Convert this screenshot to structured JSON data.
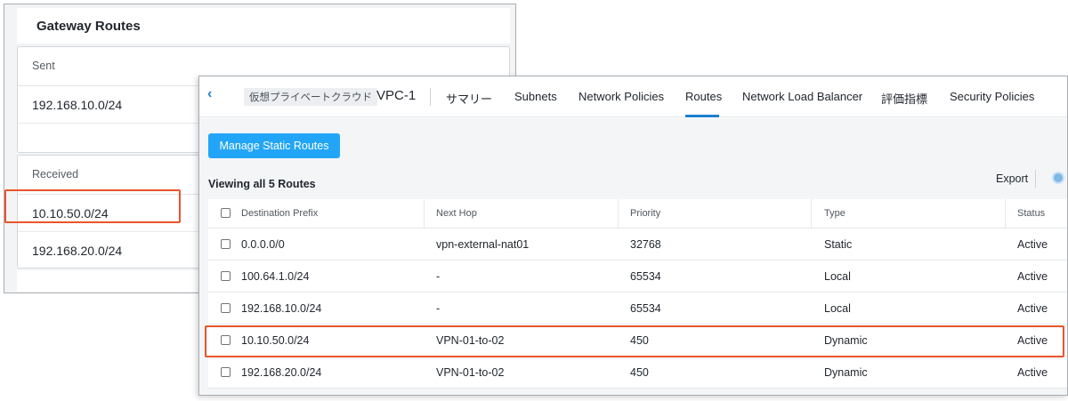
{
  "gateway": {
    "title": "Gateway Routes",
    "sent": {
      "label": "Sent",
      "routes": [
        "192.168.10.0/24"
      ]
    },
    "received": {
      "label": "Received",
      "routes": [
        "10.10.50.0/24",
        "192.168.20.0/24"
      ]
    }
  },
  "vpc": {
    "breadcrumb": "仮想プライベートクラウド",
    "name": "VPC-1",
    "tabs": [
      {
        "label": "サマリー"
      },
      {
        "label": "Subnets"
      },
      {
        "label": "Network Policies"
      },
      {
        "label": "Routes",
        "active": true
      },
      {
        "label": "Network Load Balancer"
      },
      {
        "label": "評価指標"
      },
      {
        "label": "Security Policies"
      }
    ],
    "manage_button": "Manage Static Routes",
    "viewing": "Viewing all 5 Routes",
    "export": "Export",
    "accent": "#22a5f7",
    "highlight": "#e8552c",
    "columns": [
      "Destination Prefix",
      "Next Hop",
      "Priority",
      "Type",
      "Status"
    ],
    "rows": [
      [
        "0.0.0.0/0",
        "vpn-external-nat01",
        "32768",
        "Static",
        "Active"
      ],
      [
        "100.64.1.0/24",
        "-",
        "65534",
        "Local",
        "Active"
      ],
      [
        "192.168.10.0/24",
        "-",
        "65534",
        "Local",
        "Active"
      ],
      [
        "10.10.50.0/24",
        "VPN-01-to-02",
        "450",
        "Dynamic",
        "Active"
      ],
      [
        "192.168.20.0/24",
        "VPN-01-to-02",
        "450",
        "Dynamic",
        "Active"
      ]
    ]
  }
}
